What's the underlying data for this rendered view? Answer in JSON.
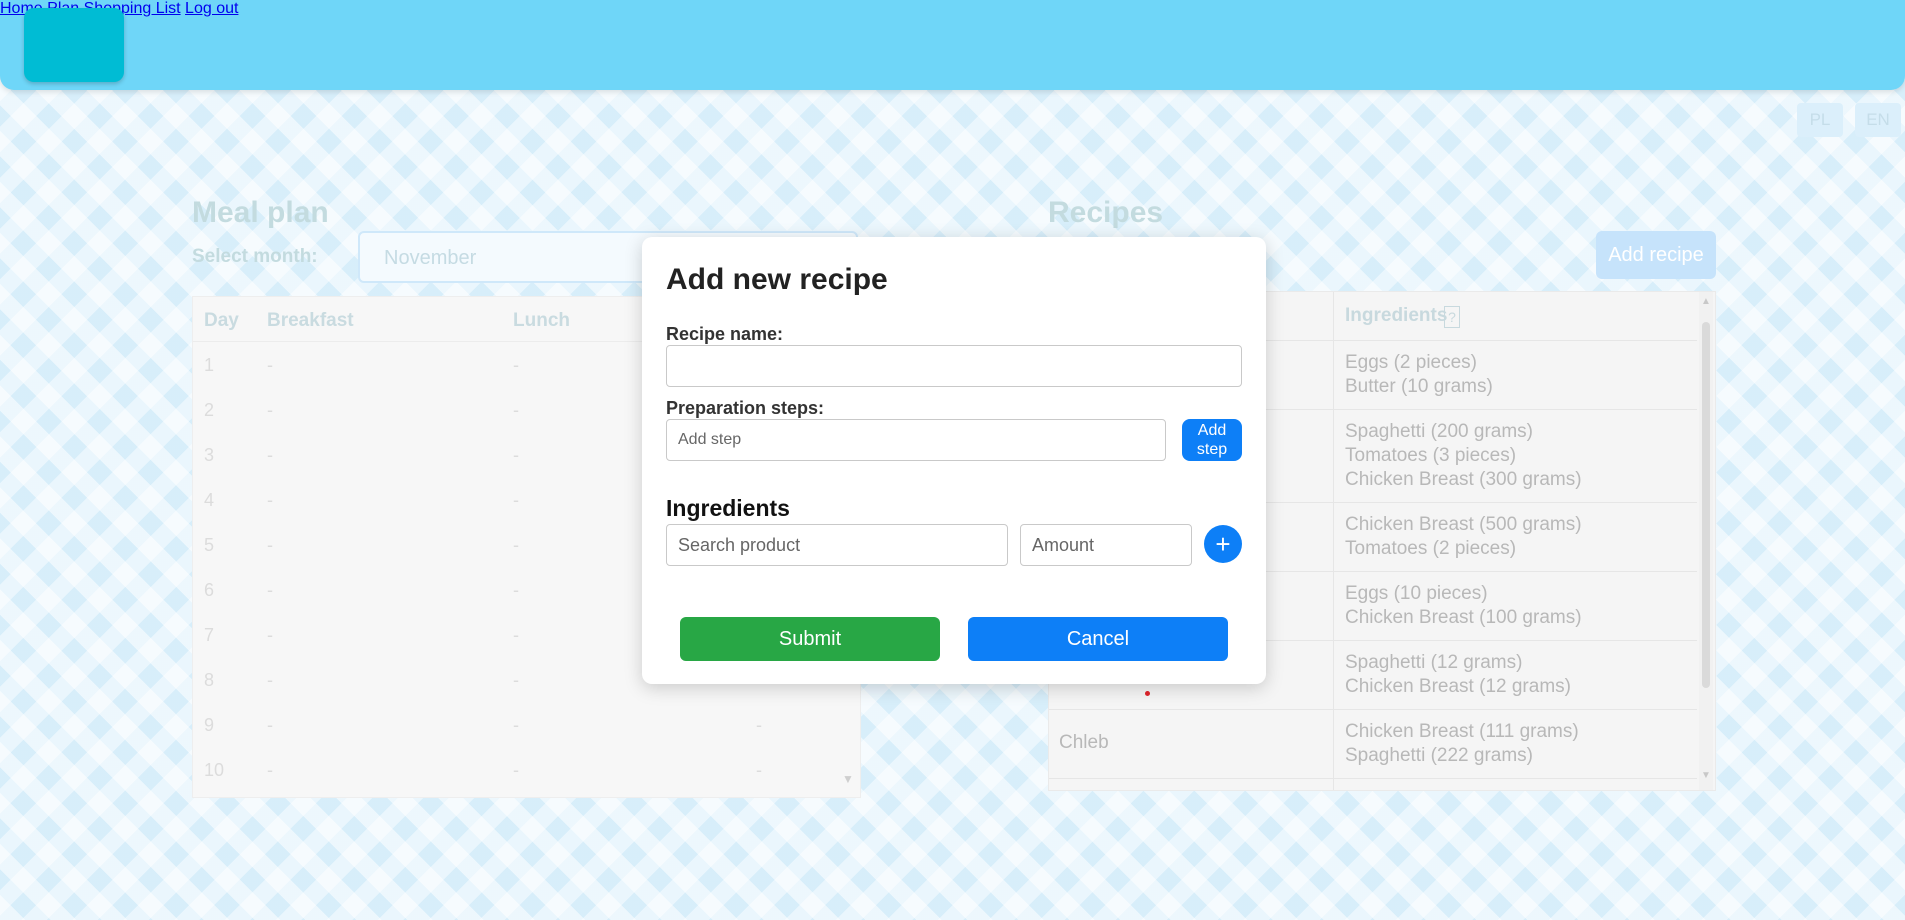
{
  "header": {
    "nav": [
      "Home",
      "Plan",
      "Shopping List",
      "Log out"
    ]
  },
  "languages": [
    "PL",
    "EN"
  ],
  "meal_plan": {
    "title": "Meal plan",
    "select_label": "Select month:",
    "month": "November",
    "columns": [
      "Day",
      "Breakfast",
      "Lunch"
    ],
    "rows": [
      {
        "day": "1",
        "breakfast": "-",
        "lunch": "-"
      },
      {
        "day": "2",
        "breakfast": "-",
        "lunch": "-"
      },
      {
        "day": "3",
        "breakfast": "-",
        "lunch": "-"
      },
      {
        "day": "4",
        "breakfast": "-",
        "lunch": "-"
      },
      {
        "day": "5",
        "breakfast": "-",
        "lunch": "-"
      },
      {
        "day": "6",
        "breakfast": "-",
        "lunch": "-"
      },
      {
        "day": "7",
        "breakfast": "-",
        "lunch": "-"
      },
      {
        "day": "8",
        "breakfast": "-",
        "lunch": "-"
      },
      {
        "day": "9",
        "breakfast": "-",
        "lunch": "-",
        "dinner": "-"
      },
      {
        "day": "10",
        "breakfast": "-",
        "lunch": "-",
        "dinner": "-"
      }
    ]
  },
  "recipes": {
    "title": "Recipes",
    "add_button": "Add recipe",
    "ingredients_header": "Ingredients",
    "help_mark": "?",
    "rows": [
      {
        "name": "",
        "ingredients": [
          "Eggs (2 pieces)",
          "Butter (10 grams)"
        ]
      },
      {
        "name": "",
        "ingredients": [
          "Spaghetti (200 grams)",
          "Tomatoes (3 pieces)",
          "Chicken Breast (300 grams)"
        ]
      },
      {
        "name": "",
        "ingredients": [
          "Chicken Breast (500 grams)",
          "Tomatoes (2 pieces)"
        ]
      },
      {
        "name": "",
        "ingredients": [
          "Eggs (10 pieces)",
          "Chicken Breast (100 grams)"
        ]
      },
      {
        "name": "",
        "ingredients": [
          "Spaghetti (12 grams)",
          "Chicken Breast (12 grams)"
        ]
      },
      {
        "name": "Chleb",
        "ingredients": [
          "Chicken Breast (111 grams)",
          "Spaghetti (222 grams)"
        ]
      }
    ]
  },
  "modal": {
    "title": "Add new recipe",
    "recipe_name_label": "Recipe name:",
    "recipe_name_value": "",
    "steps_label": "Preparation steps:",
    "step_placeholder": "Add step",
    "add_step_button": "Add step",
    "ingredients_title": "Ingredients",
    "product_placeholder": "Search product",
    "amount_placeholder": "Amount",
    "plus_glyph": "+",
    "submit_button": "Submit",
    "cancel_button": "Cancel"
  }
}
